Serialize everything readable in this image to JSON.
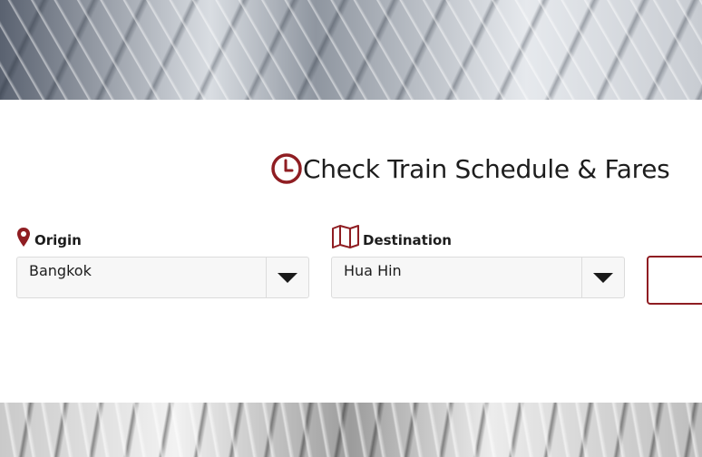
{
  "title": "Check Train Schedule & Fares",
  "origin": {
    "label": "Origin",
    "value": "Bangkok"
  },
  "destination": {
    "label": "Destination",
    "value": "Hua Hin"
  },
  "colors": {
    "accent": "#8f1d22",
    "text": "#1d1d1d",
    "select_bg": "#f7f7f7"
  },
  "icons": {
    "title": "clock-icon",
    "origin": "map-pin-icon",
    "destination": "map-icon",
    "dropdown": "caret-down-icon"
  }
}
